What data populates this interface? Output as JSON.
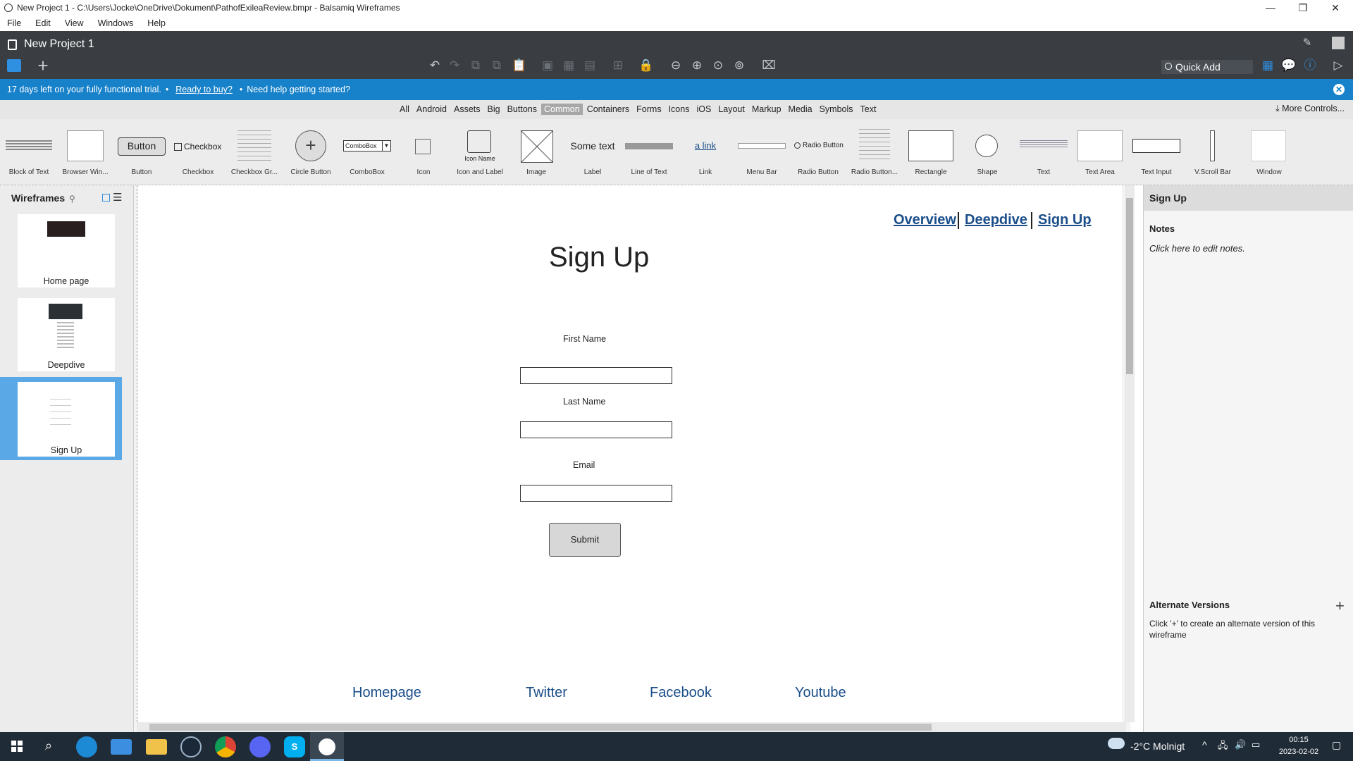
{
  "window": {
    "title": "New Project 1 - C:\\Users\\Jocke\\OneDrive\\Dokument\\PathofExileaReview.bmpr - Balsamiq Wireframes",
    "minimize_glyph": "—",
    "restore_glyph": "❐",
    "close_glyph": "✕"
  },
  "menu": [
    "File",
    "Edit",
    "View",
    "Windows",
    "Help"
  ],
  "project": {
    "title": "New Project 1"
  },
  "toolbar": {
    "quick_add": "Quick Add"
  },
  "trial": {
    "message": "17 days left on your fully functional trial.",
    "bullet1": "•",
    "buy_link": "Ready to buy?",
    "bullet2": "•",
    "help_text": "Need help getting started?",
    "close_glyph": "✕"
  },
  "categories": {
    "tabs": [
      "All",
      "Android",
      "Assets",
      "Big",
      "Buttons",
      "Common",
      "Containers",
      "Forms",
      "Icons",
      "iOS",
      "Layout",
      "Markup",
      "Media",
      "Symbols",
      "Text"
    ],
    "active": "Common",
    "more": "More Controls..."
  },
  "components": {
    "labels": [
      "Block of Text",
      "Browser Win...",
      "Button",
      "Checkbox",
      "Checkbox Gr...",
      "Circle Button",
      "ComboBox",
      "Icon",
      "Icon and Label",
      "Image",
      "Label",
      "Line of Text",
      "Link",
      "Menu Bar",
      "Radio Button",
      "Radio Button...",
      "Rectangle",
      "Shape",
      "Text",
      "Text Area",
      "Text Input",
      "V.Scroll Bar",
      "Window"
    ],
    "button_text": "Button",
    "checkbox_text": "Checkbox",
    "combobox_text": "ComboBox",
    "icon_label_text": "Icon Name",
    "label_text": "Some text",
    "link_text": "a link",
    "radio_text": "Radio Button"
  },
  "wireframes": {
    "header": "Wireframes",
    "items": [
      {
        "name": "Home page"
      },
      {
        "name": "Deepdive"
      },
      {
        "name": "Sign Up"
      }
    ],
    "selected": "Sign Up"
  },
  "page": {
    "nav": [
      "Overview",
      "Deepdive",
      "Sign Up"
    ],
    "title": "Sign Up",
    "fields": [
      {
        "label": "First Name",
        "value": ""
      },
      {
        "label": "Last Name",
        "value": ""
      },
      {
        "label": "Email",
        "value": ""
      }
    ],
    "submit": "Submit",
    "footer": [
      "Homepage",
      "Twitter",
      "Facebook",
      "Youtube"
    ]
  },
  "inspector": {
    "title": "Sign Up",
    "notes_header": "Notes",
    "notes_placeholder": "Click here to edit notes.",
    "alt_header": "Alternate Versions",
    "alt_text": "Click '+' to create an alternate version of this wireframe",
    "alt_plus": "+"
  },
  "taskbar": {
    "weather": "-2°C  Molnigt",
    "time": "00:15",
    "date": "2023-02-02"
  },
  "colors": {
    "banner": "#1781c9",
    "header": "#3a3e43",
    "link": "#1b4e8a",
    "selection": "#5aa9e6",
    "taskbar": "#1f2b36"
  }
}
